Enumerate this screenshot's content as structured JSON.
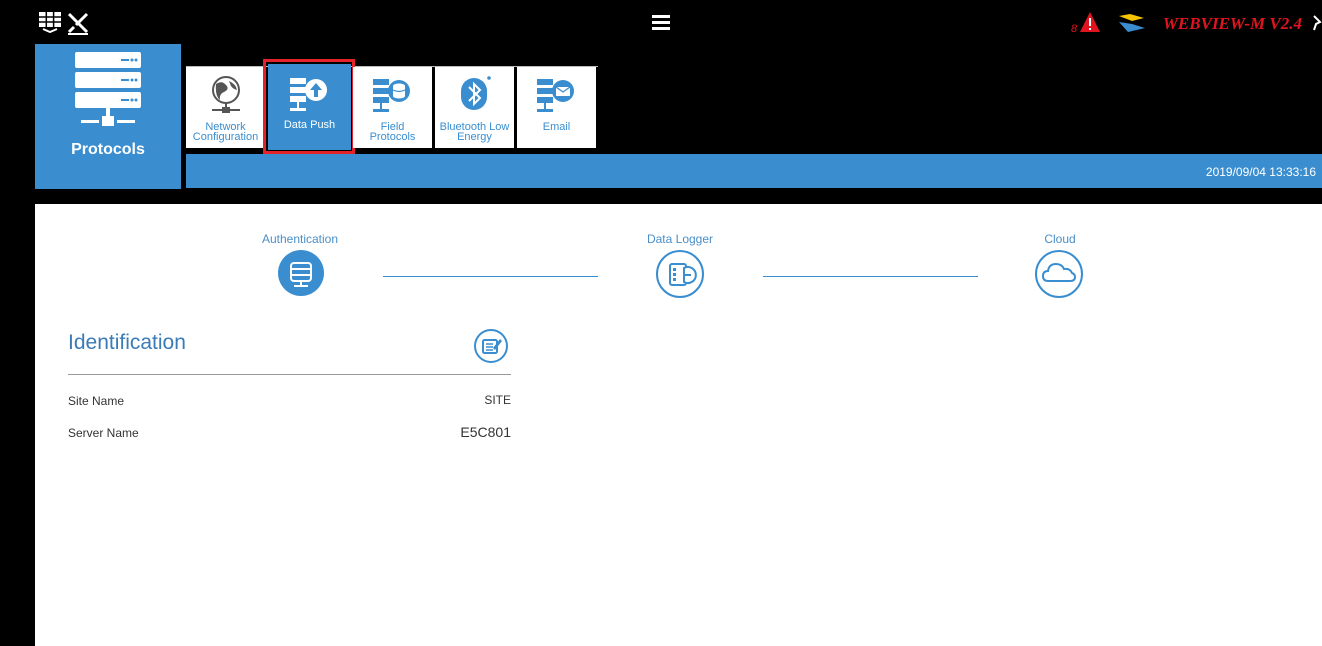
{
  "header": {
    "brand": "WEBVIEW-M V2.4",
    "alarm_count": "8"
  },
  "module": {
    "label": "Protocols"
  },
  "tabs": [
    {
      "label": "Network Configuration",
      "icon": "globe-network-icon",
      "active": false
    },
    {
      "label": "Data Push",
      "icon": "server-upload-icon",
      "active": true
    },
    {
      "label": "Field Protocols",
      "icon": "server-database-icon",
      "active": false
    },
    {
      "label": "Bluetooth Low Energy",
      "icon": "bluetooth-icon",
      "active": false
    },
    {
      "label": "Email",
      "icon": "server-email-icon",
      "active": false
    }
  ],
  "status": {
    "datetime": "2019/09/04 13:33:16"
  },
  "steps": [
    {
      "label": "Authentication",
      "icon": "server-icon",
      "active": true
    },
    {
      "label": "Data Logger",
      "icon": "data-logger-icon",
      "active": false
    },
    {
      "label": "Cloud",
      "icon": "cloud-icon",
      "active": false
    }
  ],
  "identification": {
    "title": "Identification",
    "rows": [
      {
        "label": "Site Name",
        "value": "SITE"
      },
      {
        "label": "Server Name",
        "value": "E5C801"
      }
    ]
  },
  "colors": {
    "accent": "#3a8ed0",
    "highlight": "#e32329",
    "brand": "#e0141e"
  }
}
